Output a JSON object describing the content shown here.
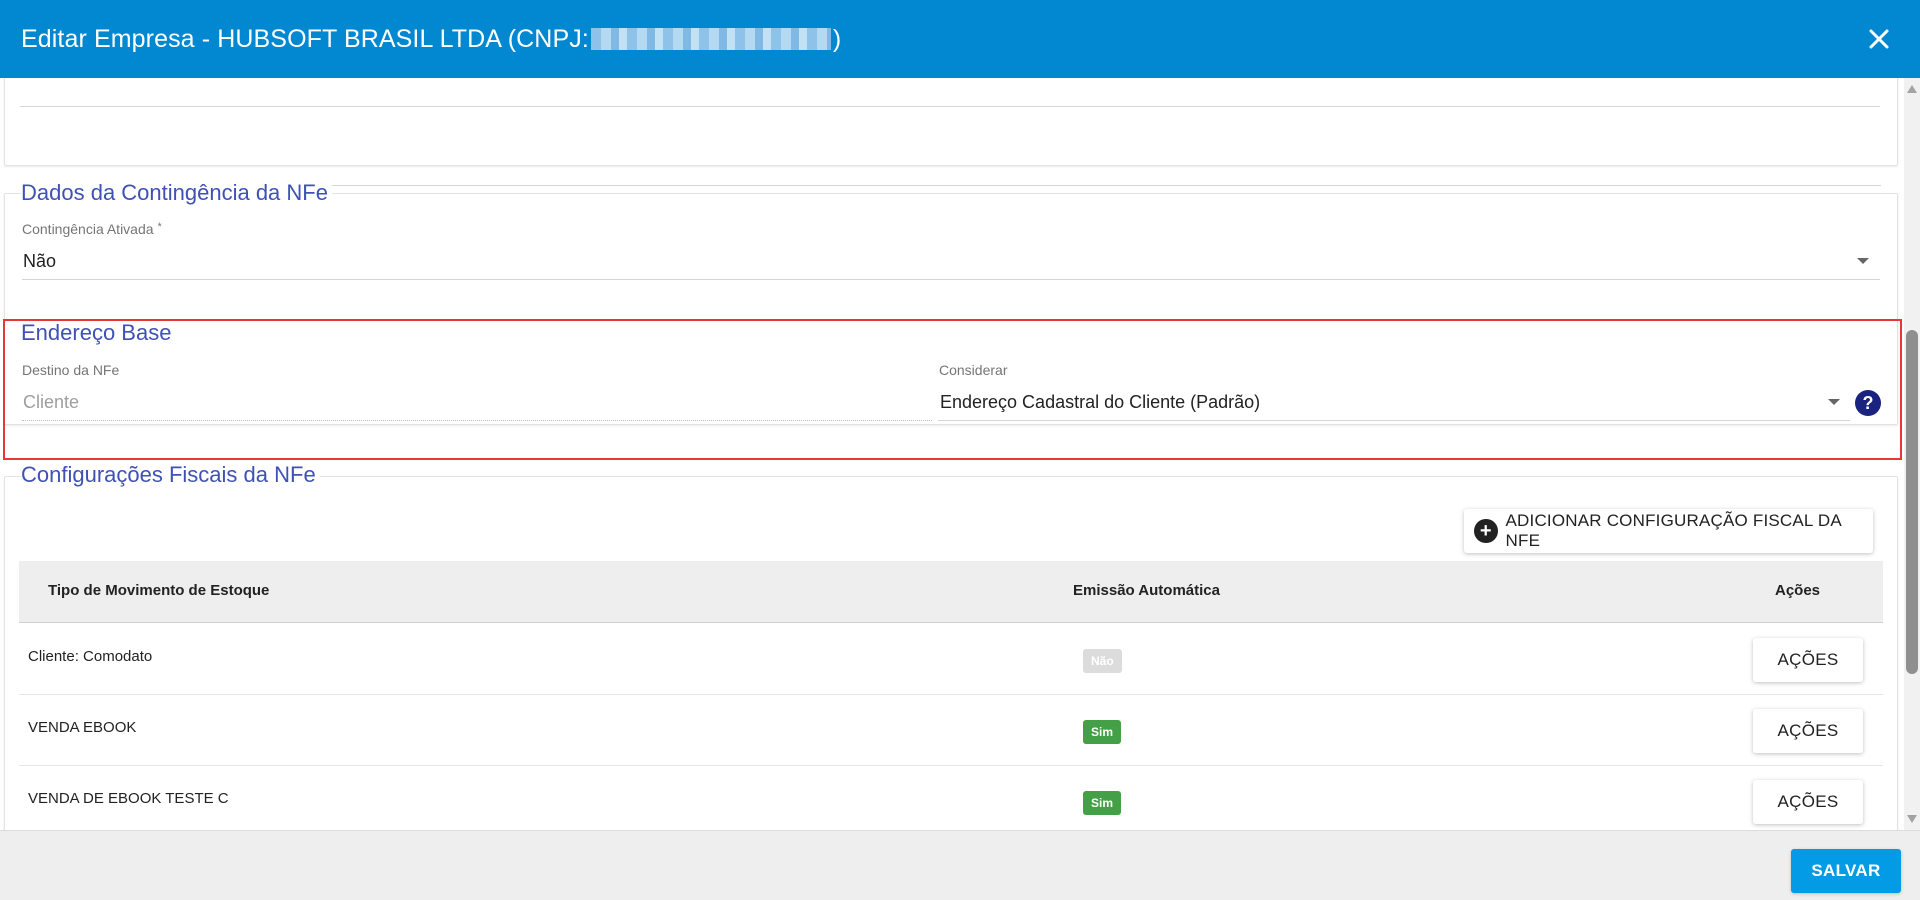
{
  "header": {
    "title_prefix": "Editar Empresa - HUBSOFT BRASIL LTDA (CNPJ: ",
    "title_suffix": ")"
  },
  "contingencia": {
    "section_title": "Dados da Contingência da NFe",
    "field_label": "Contingência Ativada",
    "required_mark": "*",
    "value": "Não"
  },
  "endereco_base": {
    "section_title": "Endereço Base",
    "destino_label": "Destino da NFe",
    "destino_value": "Cliente",
    "considerar_label": "Considerar",
    "considerar_value": "Endereço Cadastral do Cliente (Padrão)",
    "help_glyph": "?"
  },
  "config_fiscais": {
    "section_title": "Configurações Fiscais da NFe",
    "add_button_label": "ADICIONAR CONFIGURAÇÃO FISCAL DA NFE",
    "columns": [
      "Tipo de Movimento de Estoque",
      "Emissão Automática",
      "Ações"
    ],
    "rows": [
      {
        "tipo": "Cliente: Comodato",
        "emissao": "Não",
        "acoes": "AÇÕES"
      },
      {
        "tipo": "VENDA EBOOK",
        "emissao": "Sim",
        "acoes": "AÇÕES"
      },
      {
        "tipo": "VENDA DE EBOOK TESTE C",
        "emissao": "Sim",
        "acoes": "AÇÕES"
      }
    ]
  },
  "footer": {
    "save_label": "SALVAR"
  },
  "colors": {
    "header_bg": "#0288d1",
    "section_title": "#3f51b5",
    "highlight_border": "#e53935",
    "badge_yes": "#43a047",
    "badge_no": "#dcdcdc",
    "save_button": "#039be5"
  },
  "icons": {
    "close": "close-icon",
    "help": "help-icon",
    "add": "plus-circle-icon",
    "dropdown": "caret-down-icon"
  }
}
